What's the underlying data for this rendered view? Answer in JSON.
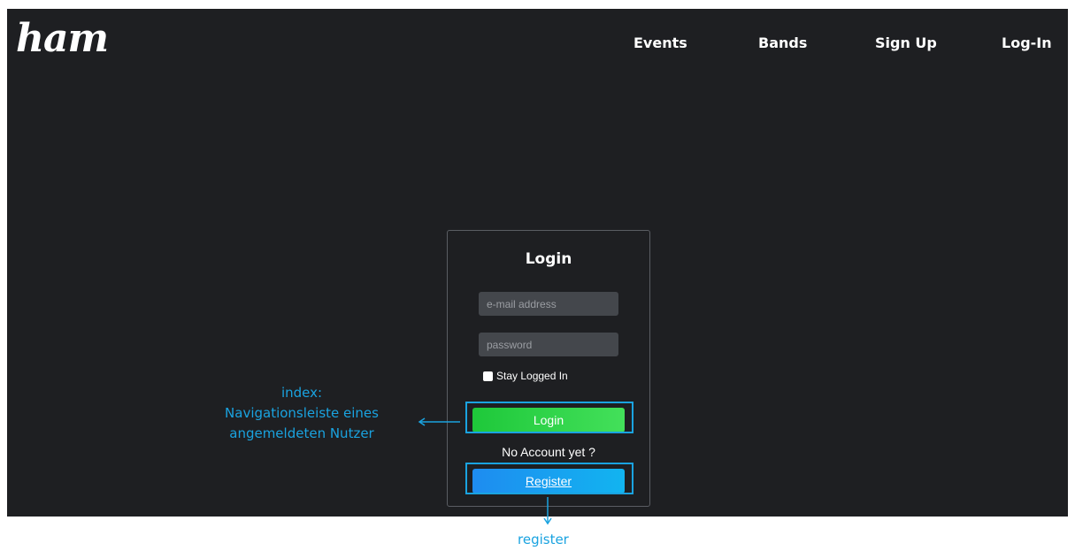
{
  "brand": {
    "logo": "ham"
  },
  "nav": {
    "events": "Events",
    "bands": "Bands",
    "sign_up": "Sign Up",
    "log_in": "Log-In"
  },
  "login": {
    "title": "Login",
    "email_placeholder": "e-mail address",
    "password_placeholder": "password",
    "stay_logged_in": "Stay Logged In",
    "login_button": "Login",
    "no_account": "No Account yet ?",
    "register_button": "Register"
  },
  "annotations": {
    "index_line1": "index:",
    "index_line2": "Navigationsleiste eines",
    "index_line3": "angemeldeten Nutzer",
    "register": "register"
  },
  "colors": {
    "background": "#1e1f22",
    "login_button": "#2fd44a",
    "register_button": "#1aa0f0",
    "annotation": "#1aa3e0"
  }
}
